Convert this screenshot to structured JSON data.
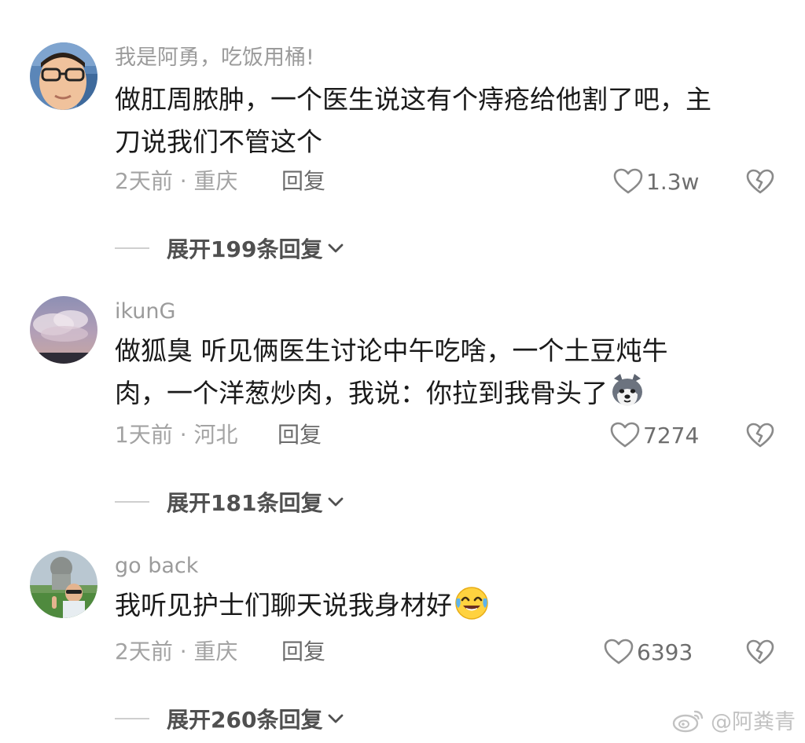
{
  "comments": [
    {
      "username": "我是阿勇，吃饭用桶!",
      "text_lines": [
        "做肛周脓肿，一个医生说这有个痔疮给他割了吧，主",
        "刀说我们不管这个"
      ],
      "meta": "2天前 · 重庆",
      "reply_label": "回复",
      "likes": "1.3w",
      "expand_label": "展开199条回复",
      "avatar_icon": "man-with-glasses-avatar"
    },
    {
      "username": "ikunG",
      "text_lines": [
        "做狐臭  听见俩医生讨论中午吃啥，一个土豆炖牛",
        "肉，一个洋葱炒肉，我说：你拉到我骨头了"
      ],
      "meta": "1天前 · 河北",
      "reply_label": "回复",
      "likes": "7274",
      "expand_label": "展开181条回复",
      "avatar_icon": "cloudy-sky-avatar",
      "emoji": "husky-dog-emoji"
    },
    {
      "username": "go back",
      "text_lines": [
        "我听见护士们聊天说我身材好"
      ],
      "meta": "2天前 · 重庆",
      "reply_label": "回复",
      "likes": "6393",
      "expand_label": "展开260条回复",
      "avatar_icon": "man-outdoors-statue-avatar",
      "emoji": "laughing-crying-emoji"
    }
  ],
  "watermark": {
    "text": "@阿粪青",
    "icon": "weibo-logo-icon"
  },
  "colors": {
    "username": "#9b9b9b",
    "meta": "#a3a3a3",
    "body_text": "#1a1a1a",
    "expand": "#505050"
  }
}
